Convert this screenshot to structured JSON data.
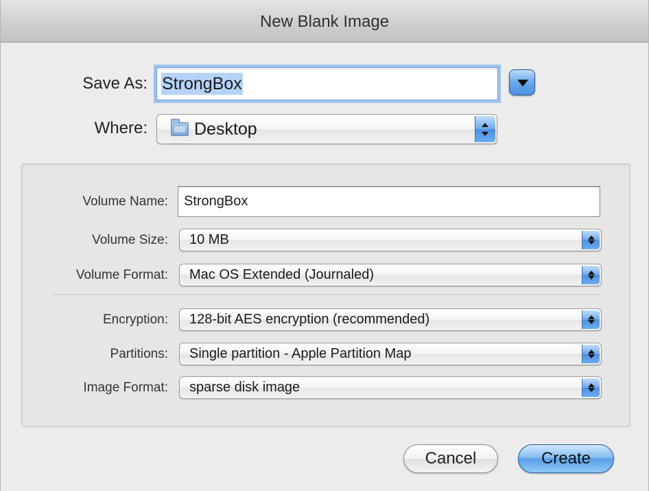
{
  "window": {
    "title": "New Blank Image"
  },
  "save_as": {
    "label": "Save As:",
    "value": "StrongBox"
  },
  "where": {
    "label": "Where:",
    "value": "Desktop",
    "icon": "folder-icon"
  },
  "options": {
    "volume_name": {
      "label": "Volume Name:",
      "value": "StrongBox"
    },
    "volume_size": {
      "label": "Volume Size:",
      "value": "10 MB"
    },
    "volume_format": {
      "label": "Volume Format:",
      "value": "Mac OS Extended (Journaled)"
    },
    "encryption": {
      "label": "Encryption:",
      "value": "128-bit AES encryption (recommended)"
    },
    "partitions": {
      "label": "Partitions:",
      "value": "Single partition - Apple Partition Map"
    },
    "image_format": {
      "label": "Image Format:",
      "value": "sparse disk image"
    }
  },
  "buttons": {
    "cancel": "Cancel",
    "create": "Create"
  },
  "colors": {
    "accent": "#6aa7ea",
    "default_button": "#5a9ee8",
    "selection": "#b5d3fb"
  }
}
